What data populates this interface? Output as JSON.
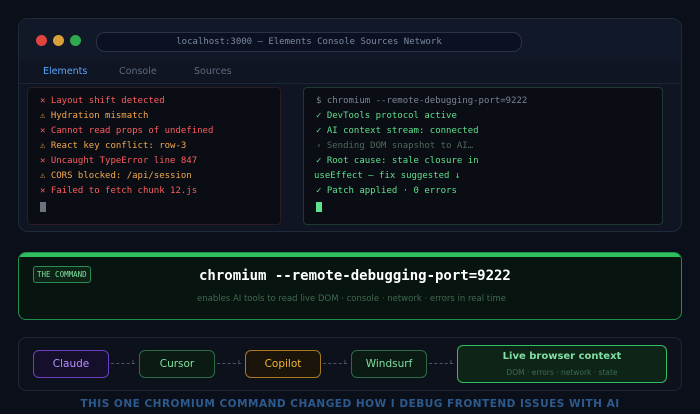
{
  "window": {
    "url": "localhost:3000 — Elements Console Sources Network",
    "tabs": [
      {
        "label": "Elements",
        "active": true
      },
      {
        "label": "Console",
        "active": false
      },
      {
        "label": "Sources",
        "active": false
      }
    ]
  },
  "errors_pane": {
    "lines": [
      {
        "icon": "✕",
        "text": "Layout shift detected",
        "kind": "error"
      },
      {
        "icon": "⚠",
        "text": "Hydration mismatch",
        "kind": "warning"
      },
      {
        "icon": "✕",
        "text": "Cannot read props of undefined",
        "kind": "error"
      },
      {
        "icon": "⚠",
        "text": "React key conflict: row-3",
        "kind": "warning"
      },
      {
        "icon": "✕",
        "text": "Uncaught TypeError line 847",
        "kind": "error"
      },
      {
        "icon": "⚠",
        "text": "CORS blocked: /api/session",
        "kind": "warning"
      },
      {
        "icon": "✕",
        "text": "Failed to fetch chunk 12.js",
        "kind": "error"
      }
    ]
  },
  "terminal_pane": {
    "command": "$ chromium --remote-debugging-port=9222",
    "lines": [
      {
        "text": "✓ DevTools protocol active",
        "kind": "ok"
      },
      {
        "text": "✓ AI context stream: connected",
        "kind": "ok"
      },
      {
        "text": "› Sending DOM snapshot to AI…",
        "kind": "muted"
      },
      {
        "text": "✓ Root cause: stale closure in",
        "kind": "ok"
      },
      {
        "text": "useEffect — fix suggested ↓",
        "kind": "ok"
      },
      {
        "text": "✓ Patch applied · 0 errors",
        "kind": "ok"
      }
    ]
  },
  "command_card": {
    "badge": "THE COMMAND",
    "command": "chromium --remote-debugging-port=9222",
    "subtitle": "enables AI tools to read live DOM · console · network · errors in real time"
  },
  "flow": {
    "nodes": [
      "Claude",
      "Cursor",
      "Copilot",
      "Windsurf"
    ],
    "target_title": "Live browser context",
    "target_sub": "DOM · errors · network · state"
  },
  "footer": "THIS ONE CHROMIUM COMMAND CHANGED HOW I DEBUG FRONTEND ISSUES WITH AI",
  "colors": {
    "error": "#ff5d5d",
    "warning": "#f6a84c",
    "success": "#5ee08c",
    "accent_blue": "#5aa7ff",
    "claude": "#b592ff",
    "copilot": "#f2b437"
  }
}
